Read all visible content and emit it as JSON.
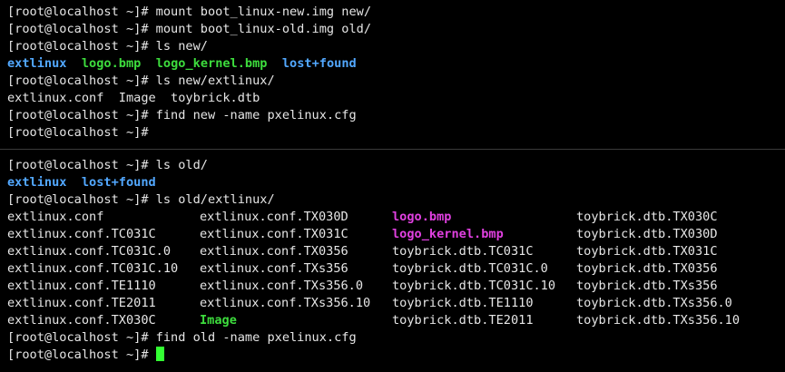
{
  "colors": {
    "background": "#000000",
    "text": "#e6e6e6",
    "directory": "#52a8ff",
    "executable": "#3ddc3d",
    "image": "#e040e0",
    "cursor": "#33ff33"
  },
  "top_pane": {
    "lines": [
      [
        {
          "t": "[root@localhost ~]# mount boot_linux-new.img new/",
          "k": "norm"
        }
      ],
      [
        {
          "t": "[root@localhost ~]# mount boot_linux-old.img old/",
          "k": "norm"
        }
      ],
      [
        {
          "t": "[root@localhost ~]# ls new/",
          "k": "norm"
        }
      ],
      [
        {
          "t": "extlinux",
          "k": "dir"
        },
        {
          "t": "  ",
          "k": "norm"
        },
        {
          "t": "logo.bmp",
          "k": "exe"
        },
        {
          "t": "  ",
          "k": "norm"
        },
        {
          "t": "logo_kernel.bmp",
          "k": "exe"
        },
        {
          "t": "  ",
          "k": "norm"
        },
        {
          "t": "lost+found",
          "k": "dir"
        }
      ],
      [
        {
          "t": "[root@localhost ~]# ls new/extlinux/",
          "k": "norm"
        }
      ],
      [
        {
          "t": "extlinux.conf  Image  toybrick.dtb",
          "k": "norm"
        }
      ],
      [
        {
          "t": "[root@localhost ~]# find new -name pxelinux.cfg",
          "k": "norm"
        }
      ],
      [
        {
          "t": "[root@localhost ~]#",
          "k": "norm"
        }
      ]
    ]
  },
  "bottom_pane": {
    "lines_before": [
      [
        {
          "t": "[root@localhost ~]# ls old/",
          "k": "norm"
        }
      ],
      [
        {
          "t": "extlinux",
          "k": "dir"
        },
        {
          "t": "  ",
          "k": "norm"
        },
        {
          "t": "lost+found",
          "k": "dir"
        }
      ],
      [
        {
          "t": "[root@localhost ~]# ls old/extlinux/",
          "k": "norm"
        }
      ]
    ],
    "listing": [
      [
        {
          "t": "extlinux.conf",
          "k": "norm"
        },
        {
          "t": "extlinux.conf.TX030D",
          "k": "norm"
        },
        {
          "t": "logo.bmp",
          "k": "img"
        },
        {
          "t": "toybrick.dtb.TX030C",
          "k": "norm"
        }
      ],
      [
        {
          "t": "extlinux.conf.TC031C",
          "k": "norm"
        },
        {
          "t": "extlinux.conf.TX031C",
          "k": "norm"
        },
        {
          "t": "logo_kernel.bmp",
          "k": "img"
        },
        {
          "t": "toybrick.dtb.TX030D",
          "k": "norm"
        }
      ],
      [
        {
          "t": "extlinux.conf.TC031C.0",
          "k": "norm"
        },
        {
          "t": "extlinux.conf.TX0356",
          "k": "norm"
        },
        {
          "t": "toybrick.dtb.TC031C",
          "k": "norm"
        },
        {
          "t": "toybrick.dtb.TX031C",
          "k": "norm"
        }
      ],
      [
        {
          "t": "extlinux.conf.TC031C.10",
          "k": "norm"
        },
        {
          "t": "extlinux.conf.TXs356",
          "k": "norm"
        },
        {
          "t": "toybrick.dtb.TC031C.0",
          "k": "norm"
        },
        {
          "t": "toybrick.dtb.TX0356",
          "k": "norm"
        }
      ],
      [
        {
          "t": "extlinux.conf.TE1110",
          "k": "norm"
        },
        {
          "t": "extlinux.conf.TXs356.0",
          "k": "norm"
        },
        {
          "t": "toybrick.dtb.TC031C.10",
          "k": "norm"
        },
        {
          "t": "toybrick.dtb.TXs356",
          "k": "norm"
        }
      ],
      [
        {
          "t": "extlinux.conf.TE2011",
          "k": "norm"
        },
        {
          "t": "extlinux.conf.TXs356.10",
          "k": "norm"
        },
        {
          "t": "toybrick.dtb.TE1110",
          "k": "norm"
        },
        {
          "t": "toybrick.dtb.TXs356.0",
          "k": "norm"
        }
      ],
      [
        {
          "t": "extlinux.conf.TX030C",
          "k": "norm"
        },
        {
          "t": "Image",
          "k": "exe"
        },
        {
          "t": "toybrick.dtb.TE2011",
          "k": "norm"
        },
        {
          "t": "toybrick.dtb.TXs356.10",
          "k": "norm"
        }
      ]
    ],
    "lines_after": [
      [
        {
          "t": "[root@localhost ~]# find old -name pxelinux.cfg",
          "k": "norm"
        }
      ]
    ],
    "prompt": "[root@localhost ~]# "
  }
}
